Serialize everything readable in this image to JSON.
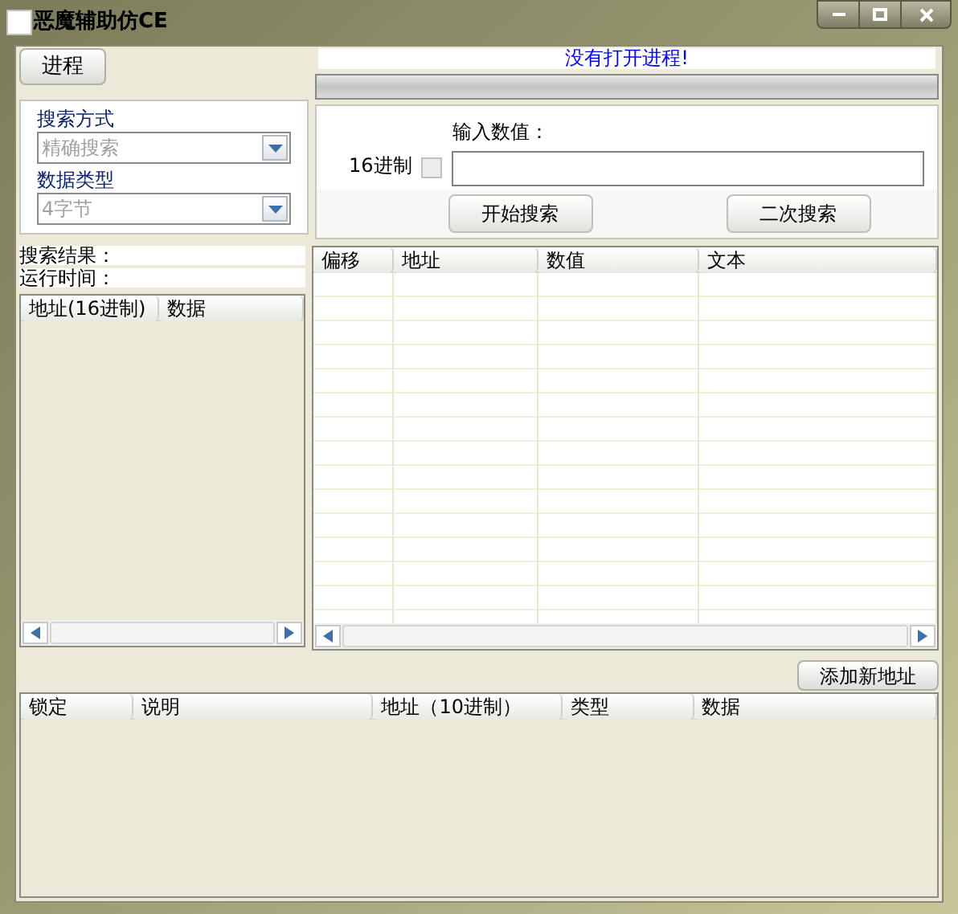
{
  "window": {
    "title": "恶魔辅助仿CE"
  },
  "process_button": "进程",
  "status": "没有打开进程!",
  "progress": {
    "level": 0
  },
  "search_mode": {
    "label": "搜索方式",
    "value": "精确搜索",
    "disabled": true
  },
  "data_type": {
    "label": "数据类型",
    "value": "4字节",
    "disabled": true
  },
  "value_input": {
    "label": "输入数值：",
    "hex_label": "16进制",
    "hex_checked": false
  },
  "buttons": [
    "开始搜索",
    "二次搜索"
  ],
  "search_result_label": "搜索结果：",
  "run_time_label": "运行时间：",
  "left_list": {
    "columns": [
      "地址(16进制)",
      "数据"
    ]
  },
  "result_table": {
    "columns": [
      "偏移",
      "地址",
      "数值",
      "文本"
    ]
  },
  "add_button": "添加新地址",
  "address_table": {
    "columns": [
      "锁定",
      "说明",
      "地址（10进制）",
      "类型",
      "数据"
    ]
  }
}
